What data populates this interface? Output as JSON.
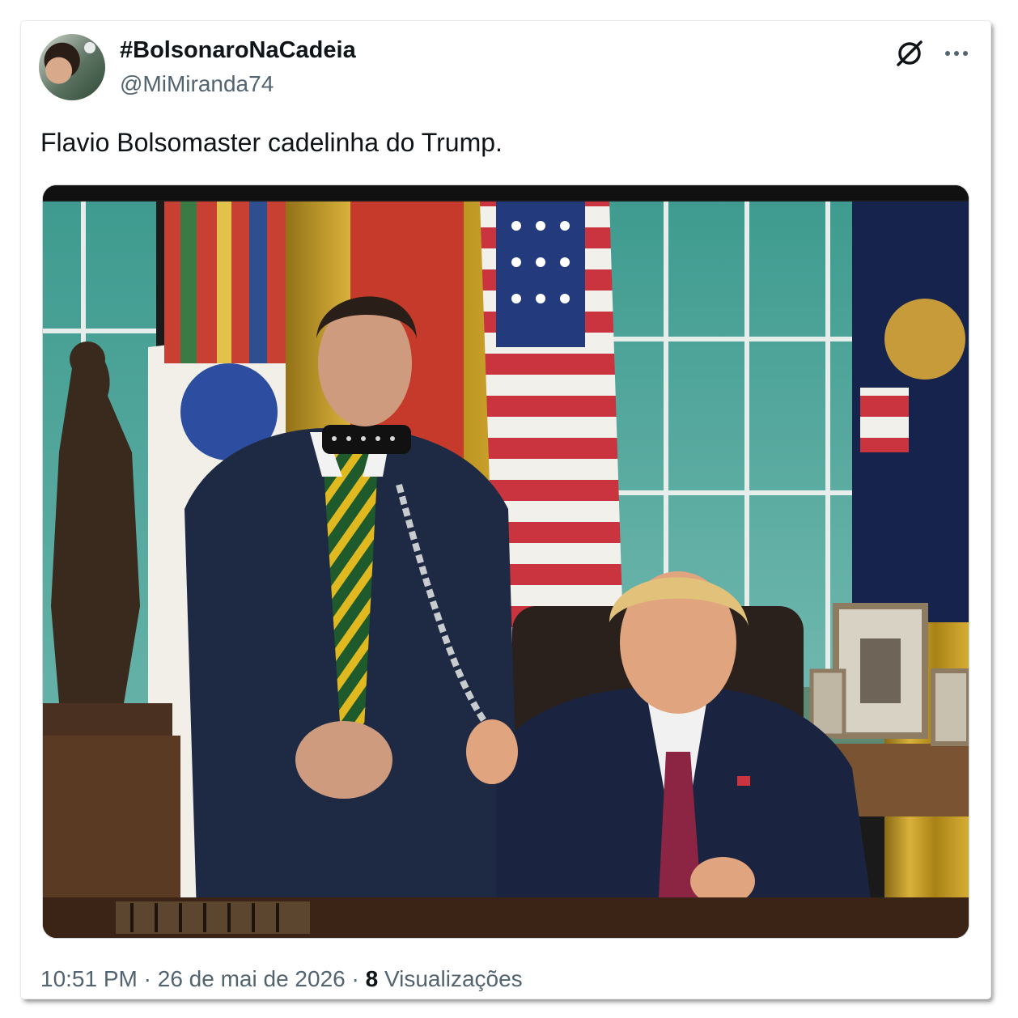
{
  "tweet": {
    "display_name": "#BolsonaroNaCadeia",
    "handle": "@MiMiranda74",
    "text": "Flavio Bolsomaster cadelinha do Trump.",
    "icons": {
      "top_right": [
        "grok-icon",
        "more-icon"
      ],
      "avatar": "avatar"
    },
    "footer": {
      "time": "10:51 PM",
      "separator": " · ",
      "date": "26 de mai de 2026",
      "views_count": "8",
      "views_label": "Visualizações"
    }
  },
  "colors": {
    "text_primary": "#0f1419",
    "text_secondary": "#536471",
    "border": "#e7e9ea"
  }
}
